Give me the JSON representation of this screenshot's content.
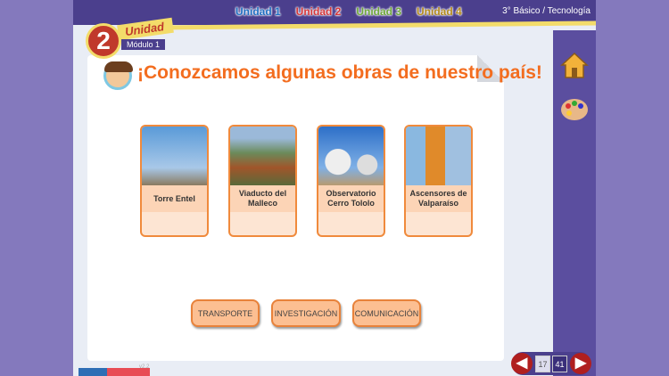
{
  "header": {
    "units": [
      {
        "label": "Unidad 1",
        "color": "#1f6fc2"
      },
      {
        "label": "Unidad 2",
        "color": "#d6373a"
      },
      {
        "label": "Unidad 3",
        "color": "#6fa83a"
      },
      {
        "label": "Unidad 4",
        "color": "#b48a1c"
      }
    ],
    "grade": "3° Básico / Tecnología"
  },
  "badge": {
    "number": "2",
    "unit_label": "Unidad",
    "module": "Módulo 1"
  },
  "title": "¡Conozcamos algunas obras de nuestro país!",
  "tiles": [
    {
      "label": "Torre Entel"
    },
    {
      "label": "Viaducto del Malleco"
    },
    {
      "label": "Observatorio Cerro Tololo"
    },
    {
      "label": "Ascensores de Valparaíso"
    }
  ],
  "buttons": [
    "TRANSPORTE",
    "INVESTIGACIÓN",
    "COMUNICACIÓN"
  ],
  "pager": {
    "current": "17",
    "total": "41"
  },
  "version": "v2.2"
}
